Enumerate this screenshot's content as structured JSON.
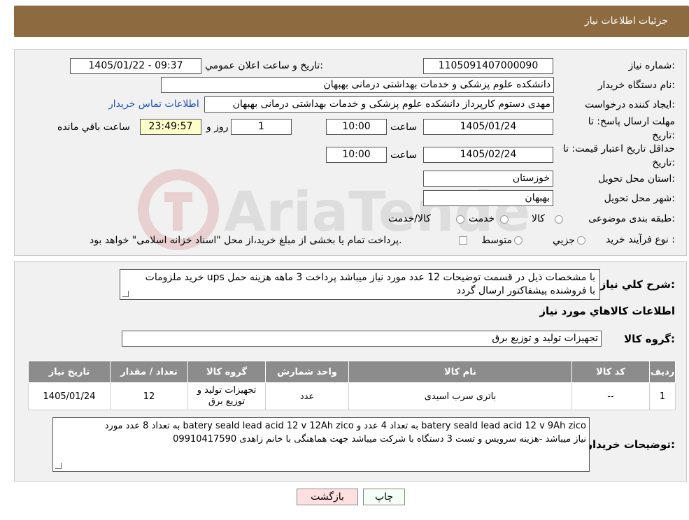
{
  "page_title": "جزئیات اطلاعات نیاز",
  "watermark_text": "AriaTender.neT",
  "fields": {
    "need_number_label": "شماره نیاز:",
    "need_number": "1105091407000090",
    "announce_label": "تاریخ و ساعت اعلان عمومي:",
    "announce_value": "1405/01/22 - 09:37",
    "buyer_org_label": "نام دستگاه خریدار:",
    "buyer_org": "دانشکده علوم پزشکی و خدمات بهداشتی  درمانی بهبهان",
    "creator_label": "ایجاد کننده درخواست:",
    "creator": "مهدی دستوم کارپرداز دانشکده علوم پزشکی و خدمات بهداشتی  درمانی بهبهان",
    "contact_link": "اطلاعات تماس خریدار",
    "deadline_label_1": "مهلت ارسال پاسخ: تا",
    "deadline_label_2": "تاریخ:",
    "deadline_date": "1405/01/24",
    "time_label": "ساعت",
    "deadline_time": "10:00",
    "days_value": "1",
    "days_label": "روز و",
    "remaining_time": "23:49:57",
    "remaining_label": "ساعت باقي مانده",
    "validity_label_1": "حداقل تاریخ اعتبار قیمت: تا",
    "validity_label_2": "تاریخ:",
    "validity_date": "1405/02/24",
    "validity_time_label": "ساعت",
    "validity_time": "10:00",
    "province_label": "استان محل تحویل:",
    "province": "خوزستان",
    "city_label": "شهر محل تحویل:",
    "city": "بهبهان",
    "category_label": "طبقه بندی موضوعی:",
    "category_options": [
      "کالا",
      "خدمت",
      "کالا/خدمت"
    ],
    "process_label": "نوع فرآیند خرید :",
    "process_options": [
      "جزیي",
      "متوسط"
    ],
    "process_note": "پرداخت تمام یا بخشی از مبلغ خرید،از محل \"اسناد خزانه اسلامی\" خواهد بود."
  },
  "summary": {
    "label": "شرح کلي نیاز:",
    "text_line1": "خرید ملزومات ups با مشخصات ذیل در قسمت توضیحات 12 عدد مورد نیاز میباشد پرداخت 3 ماهه هزینه حمل",
    "text_line2": "با فروشنده پیشفاکتور ارسال گردد"
  },
  "goods_info_title": "اطلاعات کالاهاي مورد نیاز",
  "goods_group": {
    "label": "گروه کالا:",
    "value": "تجهیزات تولید و توزیع برق"
  },
  "table": {
    "headers": [
      "ردیف",
      "کد کالا",
      "نام کالا",
      "واحد شمارش",
      "گروه کالا",
      "تعداد / مقدار",
      "تاریخ نیاز"
    ],
    "rows": [
      {
        "row": "1",
        "code": "--",
        "name": "باتری سرب اسیدی",
        "unit": "عدد",
        "group_line1": "تجهیزات تولید و",
        "group_line2": "توزیع برق",
        "qty": "12",
        "date": "1405/01/24"
      }
    ]
  },
  "buyer_notes": {
    "label": "توضیحات خریدار:",
    "line1": "batery seald lead acid 12 v    9Ah zico  به تعداد 4 عدد و batery seald lead acid 12 v   12Ah zico  به تعداد 8 عدد مورد",
    "line2": "نیاز میباشد -هزینه سرویس و تست 3 دستگاه با شرکت میباشد جهت هماهنگی با خانم زاهدی 09910417590"
  },
  "buttons": {
    "print": "چاپ",
    "back": "بازگشت"
  }
}
